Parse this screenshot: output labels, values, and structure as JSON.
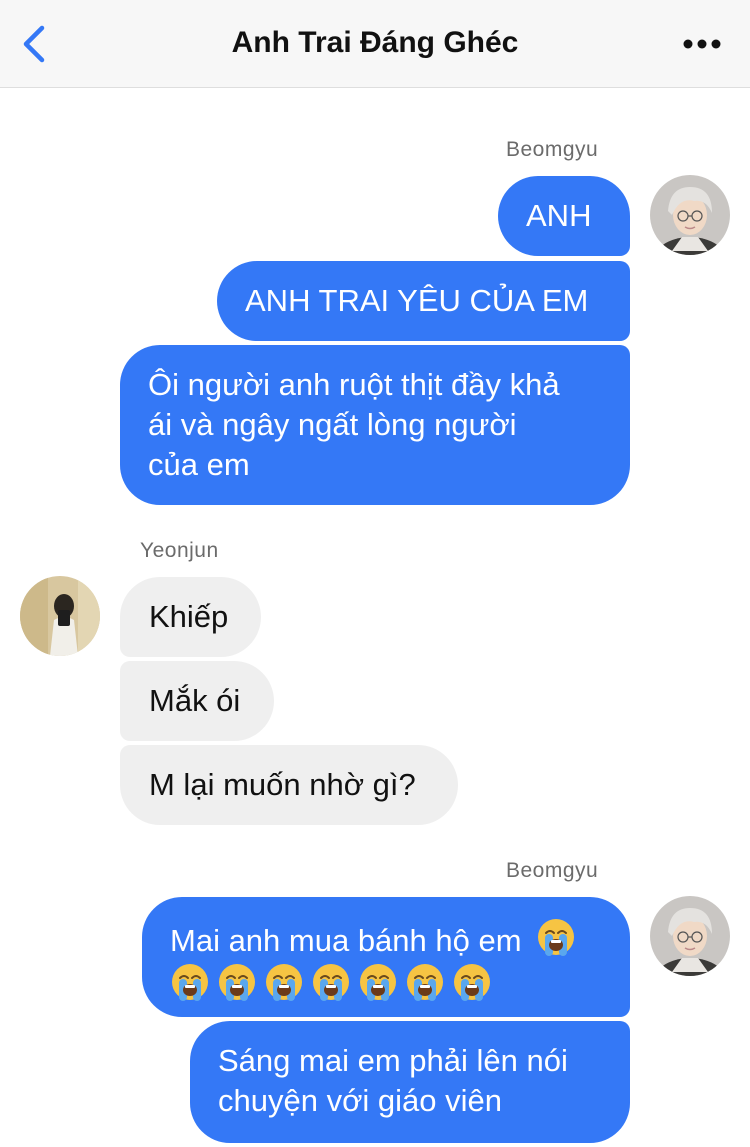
{
  "header": {
    "title": "Anh Trai Đáng Ghéc",
    "back_icon": "chevron-left-icon",
    "more_icon": "more-horizontal-icon"
  },
  "colors": {
    "accent": "#3478f6",
    "outgoing_bubble": "#3478f6",
    "incoming_bubble": "#efefef",
    "header_bg": "#f7f7f7"
  },
  "messages": [
    {
      "sender": "Beomgyu",
      "direction": "outgoing",
      "bubbles": [
        {
          "lines": [
            "ANH"
          ]
        },
        {
          "lines": [
            "ANH TRAI YÊU CỦA EM"
          ]
        },
        {
          "lines": [
            "Ôi người anh ruột thịt đầy khả",
            "ái và ngây ngất lòng người",
            "của em"
          ]
        }
      ]
    },
    {
      "sender": "Yeonjun",
      "direction": "incoming",
      "bubbles": [
        {
          "lines": [
            "Khiếp"
          ]
        },
        {
          "lines": [
            "Mắk ói"
          ]
        },
        {
          "lines": [
            "M lại muốn nhờ gì?"
          ]
        }
      ]
    },
    {
      "sender": "Beomgyu",
      "direction": "outgoing",
      "bubbles": [
        {
          "lines": [
            "Mai anh mua bánh hộ em"
          ],
          "emoji": "loudly-crying-face-icon",
          "emoji_count": 8
        },
        {
          "lines": [
            "Sáng mai em phải lên nói",
            "chuyện với giáo viên"
          ]
        }
      ]
    }
  ]
}
